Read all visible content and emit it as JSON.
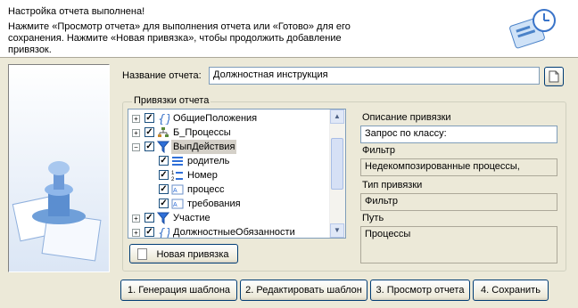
{
  "header": {
    "title": "Настройка отчета выполнена!",
    "description": "Нажмите «Просмотр отчета» для выполнения отчета или «Готово» для его сохранения. Нажмите «Новая привязка», чтобы продолжить добавление привязок."
  },
  "report_name": {
    "label": "Название отчета:",
    "value": "Должностная инструкция"
  },
  "bindings_group": {
    "title": "Привязки отчета"
  },
  "tree": [
    {
      "label": "ОбщиеПоложения",
      "icon": "braces-icon",
      "checked": true,
      "expander": "+"
    },
    {
      "label": "Б_Процессы",
      "icon": "hierarchy-icon",
      "checked": true,
      "expander": "+"
    },
    {
      "label": "ВыпДействия",
      "icon": "filter-icon",
      "checked": true,
      "expander": "-",
      "selected": true
    },
    {
      "label": "родитель",
      "icon": "list-icon",
      "checked": true
    },
    {
      "label": "Номер",
      "icon": "numbered-list-icon",
      "checked": true
    },
    {
      "label": "процесс",
      "icon": "text-field-icon",
      "checked": true
    },
    {
      "label": "требования",
      "icon": "text-field-icon",
      "checked": true
    },
    {
      "label": "Участие",
      "icon": "filter-icon",
      "checked": true,
      "expander": "+"
    },
    {
      "label": "ДолжностныеОбязанности",
      "icon": "braces-icon",
      "checked": true,
      "expander": "+"
    }
  ],
  "details": {
    "desc_label": "Описание привязки",
    "desc_value": "Запрос по классу:",
    "filter_label": "Фильтр",
    "filter_value": "Недекомпозированные процессы,",
    "type_label": "Тип привязки",
    "type_value": "Фильтр",
    "path_label": "Путь",
    "path_value": "Процессы"
  },
  "buttons": {
    "new_binding": "Новая привязка",
    "step1": "1. Генерация шаблона",
    "step2": "2. Редактировать шаблон",
    "step3": "3. Просмотр отчета",
    "step4": "4. Сохранить"
  },
  "colors": {
    "accent": "#316ac5",
    "filter_icon": "#2f6fd8",
    "braces_icon": "#3a74c9"
  }
}
